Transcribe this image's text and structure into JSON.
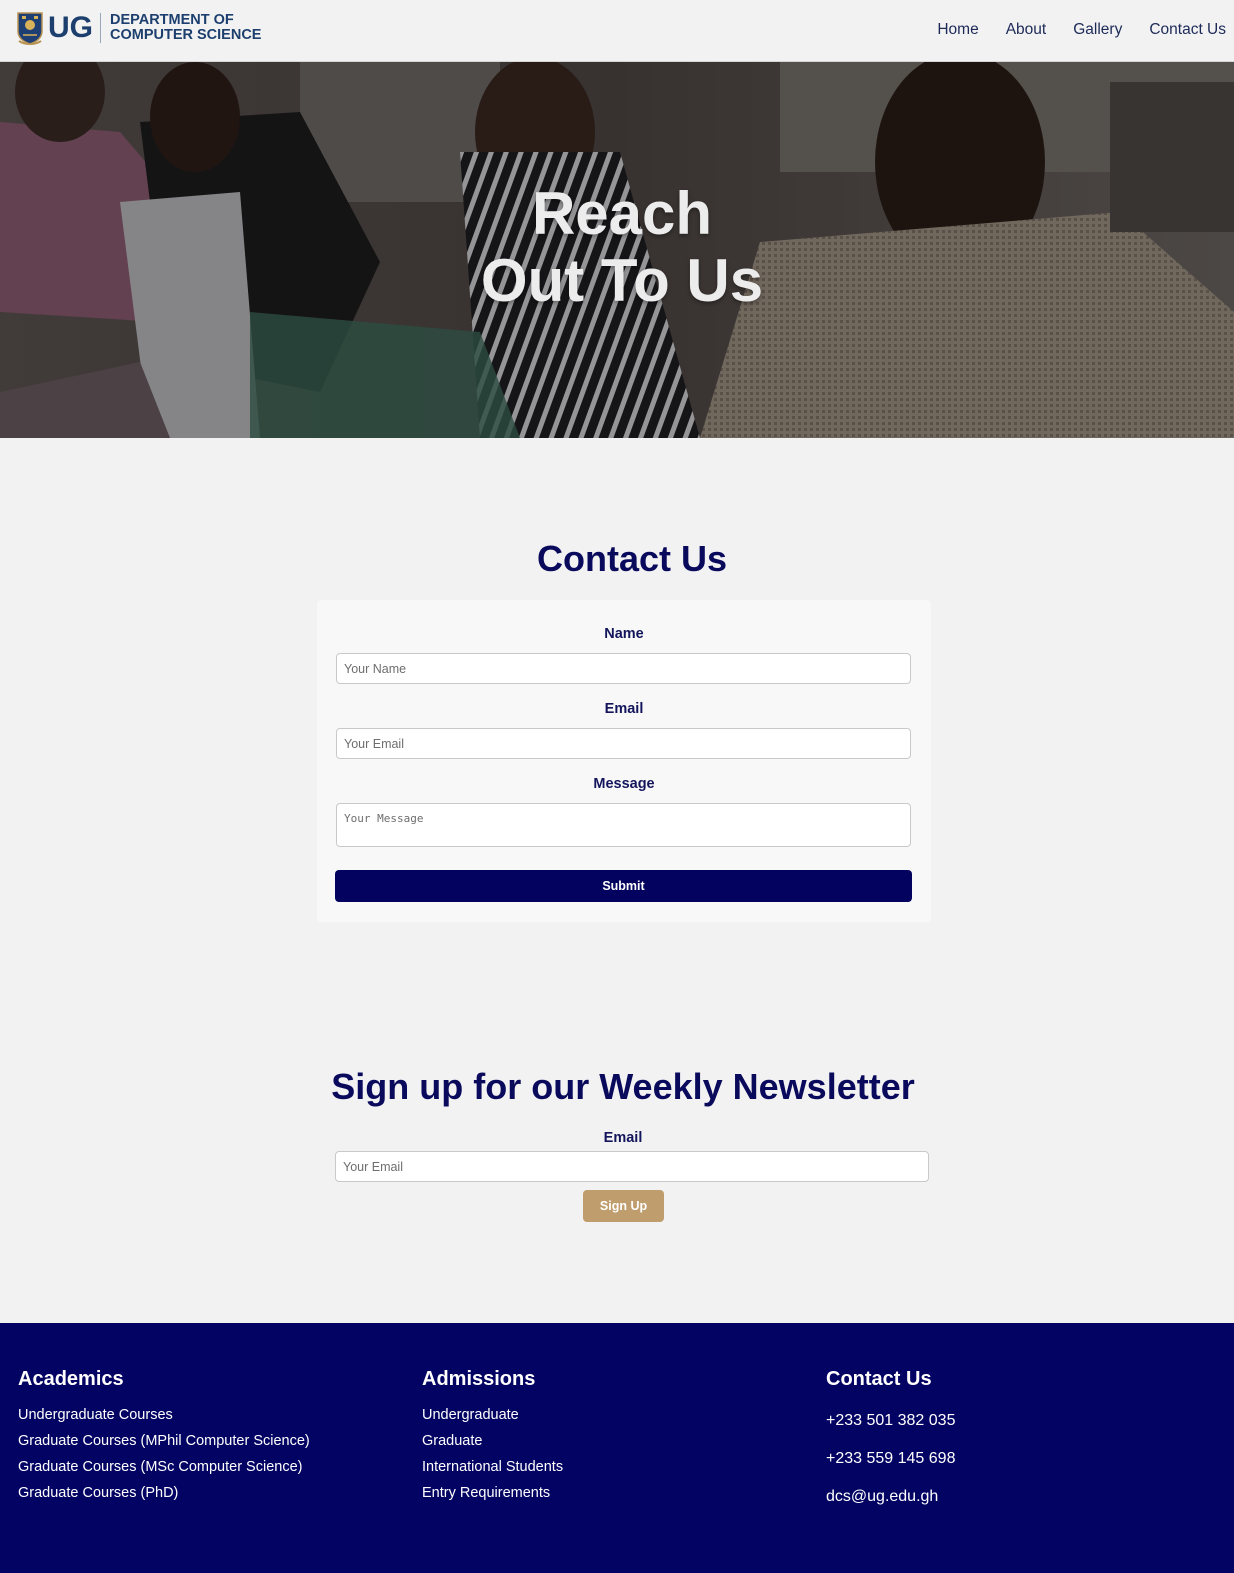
{
  "header": {
    "logo_text": "UG",
    "dept_line1": "DEPARTMENT OF",
    "dept_line2": "COMPUTER SCIENCE",
    "nav": [
      "Home",
      "About",
      "Gallery",
      "Contact Us"
    ]
  },
  "hero": {
    "title_line1": "Reach",
    "title_line2": "Out To Us"
  },
  "contact": {
    "heading": "Contact Us",
    "name_label": "Name",
    "name_placeholder": "Your Name",
    "email_label": "Email",
    "email_placeholder": "Your Email",
    "message_label": "Message",
    "message_placeholder": "Your Message",
    "submit_label": "Submit"
  },
  "newsletter": {
    "heading": "Sign up for our Weekly Newsletter",
    "email_label": "Email",
    "email_placeholder": "Your Email",
    "signup_label": "Sign Up"
  },
  "footer": {
    "academics": {
      "title": "Academics",
      "items": [
        "Undergraduate Courses",
        "Graduate Courses (MPhil Computer Science)",
        "Graduate Courses (MSc Computer Science)",
        "Graduate Courses (PhD)"
      ]
    },
    "admissions": {
      "title": "Admissions",
      "items": [
        "Undergraduate",
        "Graduate",
        "International Students",
        "Entry Requirements"
      ]
    },
    "contact": {
      "title": "Contact Us",
      "items": [
        "+233 501 382 035",
        "+233 559 145 698",
        "dcs@ug.edu.gh"
      ]
    }
  },
  "colors": {
    "brand_navy": "#03035f",
    "heading_navy": "#0a0a5c",
    "signup_gold": "#bf9d6d",
    "footer_bg": "#030363"
  }
}
